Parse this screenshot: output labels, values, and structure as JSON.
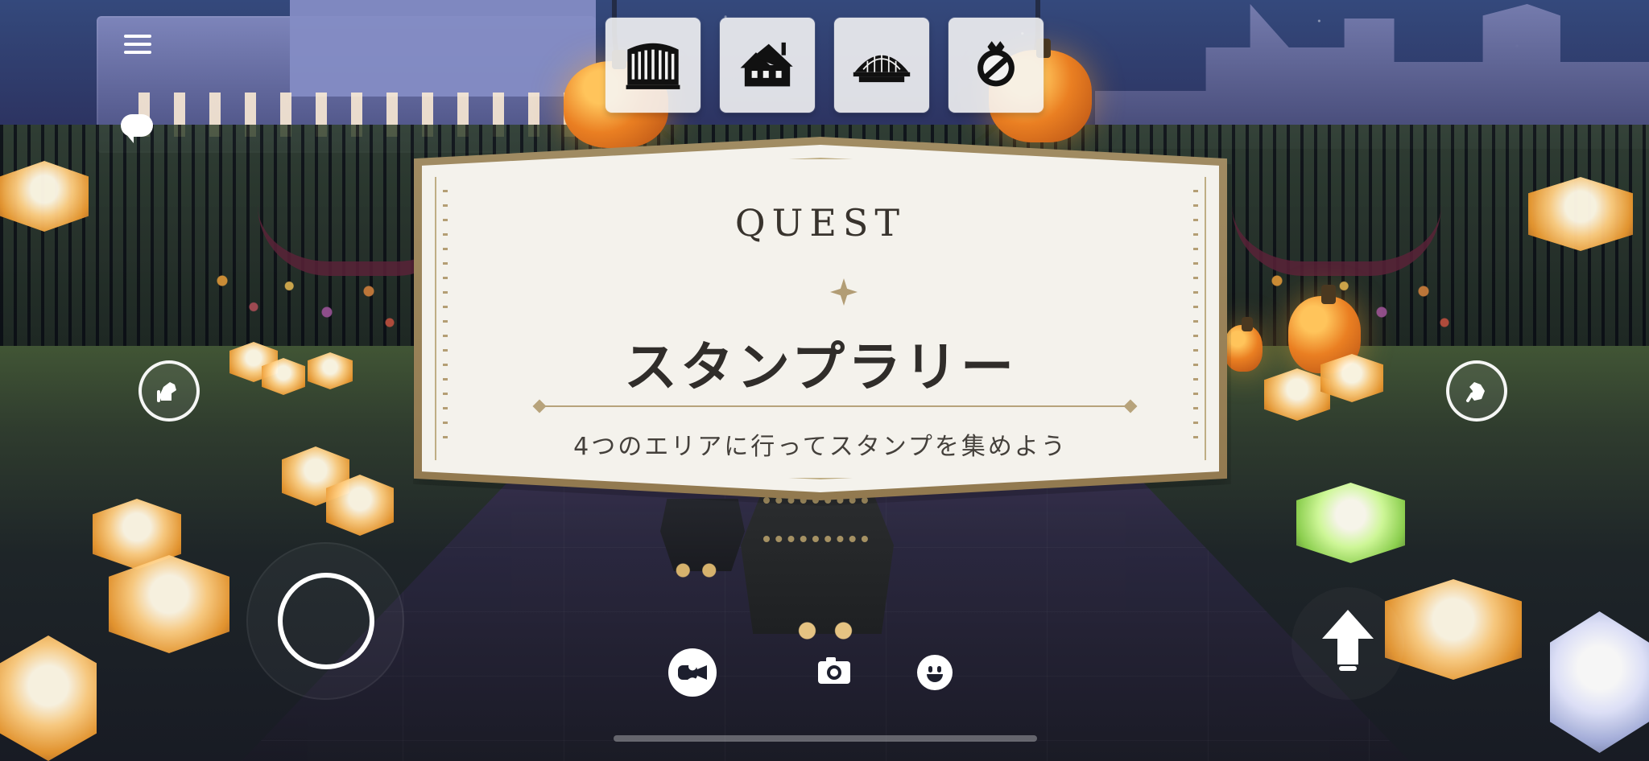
{
  "quest": {
    "heading": "QUEST",
    "title": "スタンプラリー",
    "subtitle": "4つのエリアに行ってスタンプを集めよう"
  },
  "hud": {
    "top_area_icons": [
      "colosseum-icon",
      "house-icon",
      "dome-icon",
      "emblem-icon"
    ],
    "left_controls": [
      "menu-icon",
      "chat-icon",
      "wave-icon",
      "joystick"
    ],
    "right_controls": [
      "wave-icon",
      "jump-button"
    ],
    "bottom_controls": [
      "camera-mode-icon",
      "person-icon",
      "photo-camera-icon",
      "emote-icon"
    ]
  },
  "colors": {
    "quest_frame": "#9f8a61",
    "quest_paper": "#f4f2ec",
    "quest_text": "#302d2a",
    "hud_white": "#ffffff"
  }
}
